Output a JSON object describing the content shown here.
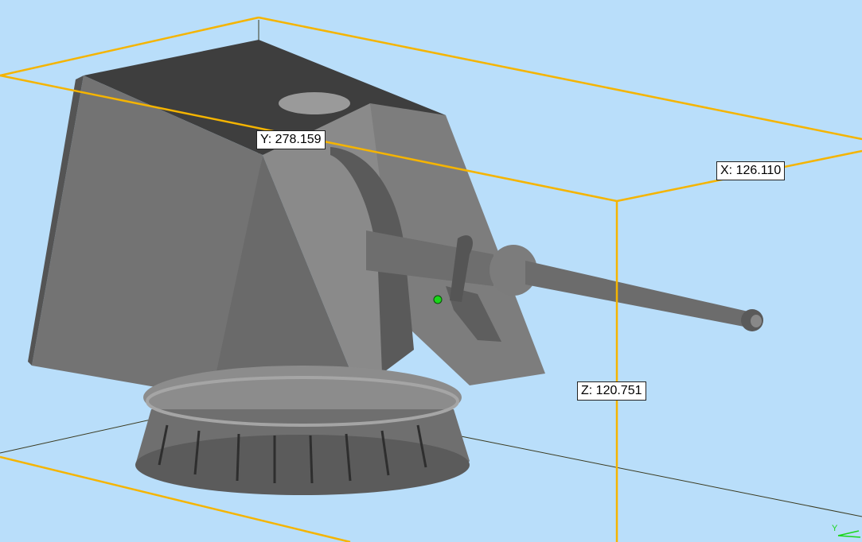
{
  "viewport": {
    "background_color": "#b9defa",
    "bounding_box_color": "#f5b400",
    "model_color": "#7a7a7a",
    "picked_point_color": "#1ad61a"
  },
  "dimensions": {
    "y_label": "Y: 278.159",
    "x_label": "X: 126.110",
    "z_label": "Z: 120.751"
  },
  "axis_triad": {
    "visible_axis": "Y"
  }
}
